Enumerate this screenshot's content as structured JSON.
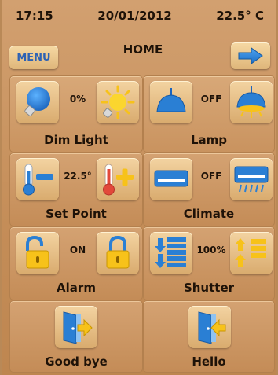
{
  "status": {
    "time": "17:15",
    "date": "20/01/2012",
    "temperature": "22.5° C"
  },
  "header": {
    "menu_label": "MENU",
    "title": "HOME"
  },
  "tiles": {
    "dim_light": {
      "label": "Dim Light",
      "value": "0%"
    },
    "lamp": {
      "label": "Lamp",
      "value": "OFF"
    },
    "set_point": {
      "label": "Set Point",
      "value": "22.5°"
    },
    "climate": {
      "label": "Climate",
      "value": "OFF"
    },
    "alarm": {
      "label": "Alarm",
      "value": "ON"
    },
    "shutter": {
      "label": "Shutter",
      "value": "100%"
    },
    "good_bye": {
      "label": "Good bye"
    },
    "hello": {
      "label": "Hello"
    }
  },
  "colors": {
    "accent_blue": "#2a7fd4",
    "accent_yellow": "#f7c21a",
    "text_dark": "#1e1208",
    "background": "#c89462"
  }
}
